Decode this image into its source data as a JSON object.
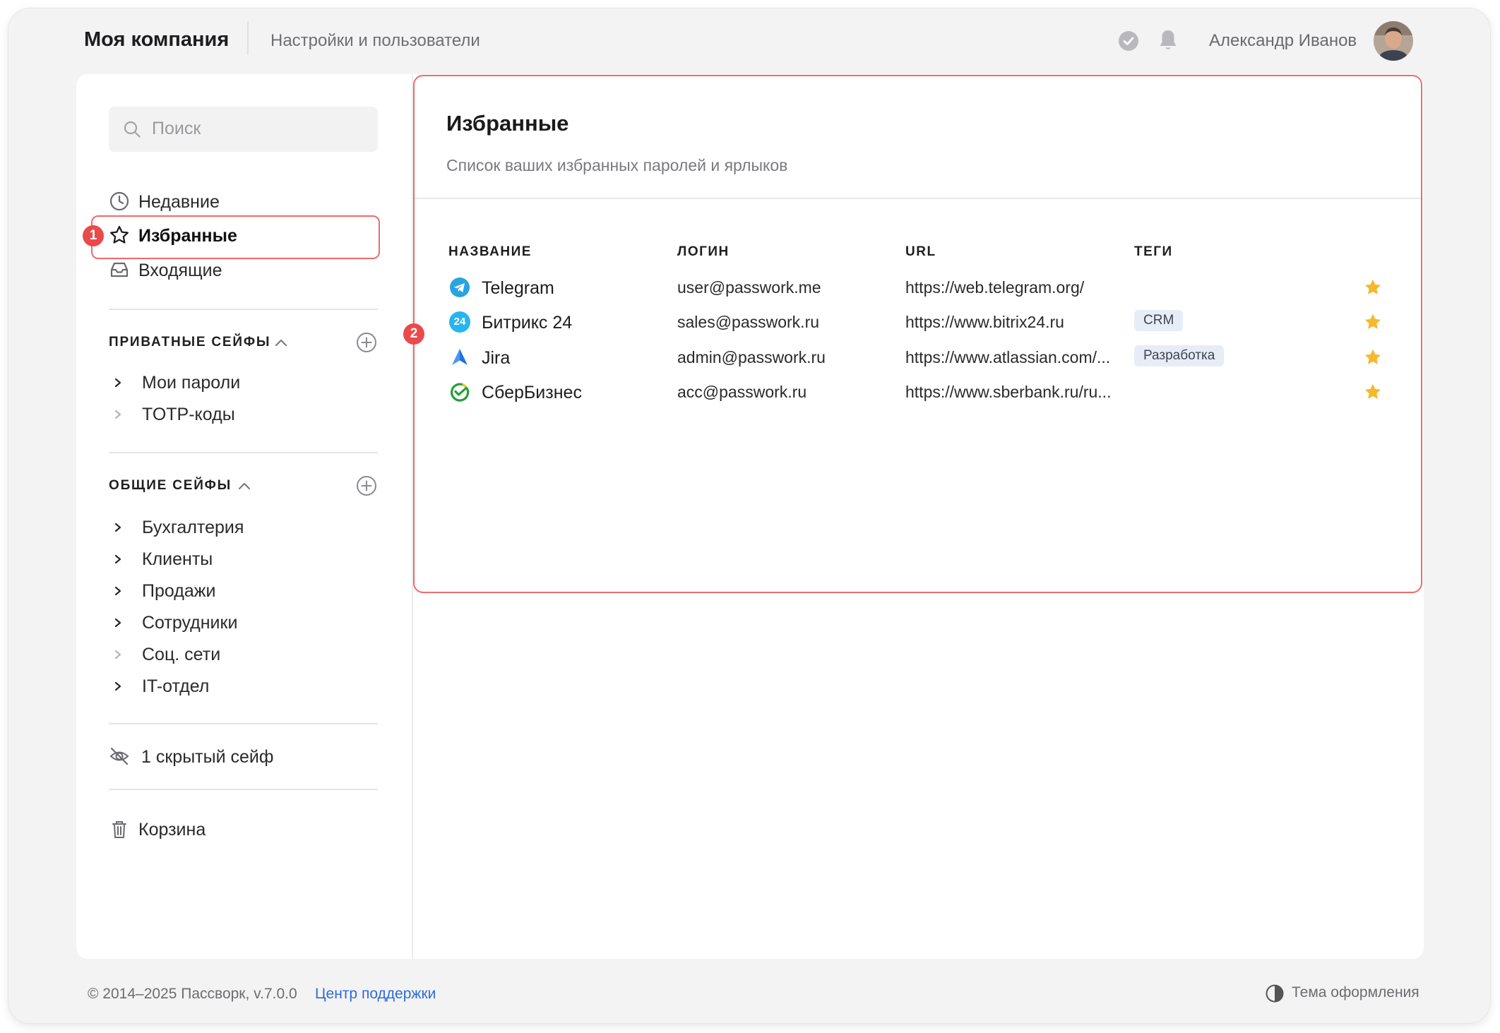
{
  "header": {
    "company": "Моя компания",
    "settings_link": "Настройки и пользователи",
    "user_name": "Александр Иванов"
  },
  "sidebar": {
    "search_placeholder": "Поиск",
    "nav": [
      {
        "label": "Недавние",
        "icon": "clock-icon"
      },
      {
        "label": "Избранные",
        "icon": "star-outline-icon"
      },
      {
        "label": "Входящие",
        "icon": "inbox-icon"
      }
    ],
    "private_safes": {
      "title": "ПРИВАТНЫЕ СЕЙФЫ",
      "items": [
        {
          "label": "Мои пароли"
        },
        {
          "label": "TOTP-коды"
        }
      ]
    },
    "shared_safes": {
      "title": "ОБЩИЕ СЕЙФЫ",
      "items": [
        {
          "label": "Бухгалтерия"
        },
        {
          "label": "Клиенты"
        },
        {
          "label": "Продажи"
        },
        {
          "label": "Сотрудники"
        },
        {
          "label": "Соц. сети"
        },
        {
          "label": "IT-отдел"
        }
      ]
    },
    "hidden_safes": "1 скрытый сейф",
    "trash": "Корзина"
  },
  "annotations": {
    "badge1": "1",
    "badge2": "2"
  },
  "main": {
    "title": "Избранные",
    "subtitle": "Список ваших избранных паролей и ярлыков",
    "columns": {
      "name": "НАЗВАНИЕ",
      "login": "ЛОГИН",
      "url": "URL",
      "tags": "ТЕГИ"
    },
    "rows": [
      {
        "name": "Telegram",
        "login": "user@passwork.me",
        "url": "https://web.telegram.org/",
        "tag": "",
        "icon": "telegram-icon"
      },
      {
        "name": "Битрикс 24",
        "login": "sales@passwork.ru",
        "url": "https://www.bitrix24.ru",
        "tag": "CRM",
        "icon": "bitrix24-icon",
        "icon_text": "24"
      },
      {
        "name": "Jira",
        "login": "admin@passwork.ru",
        "url": "https://www.atlassian.com/...",
        "tag": "Разработка",
        "icon": "jira-icon"
      },
      {
        "name": "СберБизнес",
        "login": "acc@passwork.ru",
        "url": "https://www.sberbank.ru/ru...",
        "tag": "",
        "icon": "sberbusiness-icon"
      }
    ]
  },
  "footer": {
    "copyright": "© 2014–2025 Пассворк, v.7.0.0",
    "support": "Центр поддержки",
    "theme": "Тема оформления"
  },
  "colors": {
    "accent_red": "#ef6b6b",
    "badge_red": "#ea4a4a",
    "link_blue": "#2f6bd6",
    "star_yellow": "#f5b82e",
    "tag_bg": "#e6edf7"
  }
}
